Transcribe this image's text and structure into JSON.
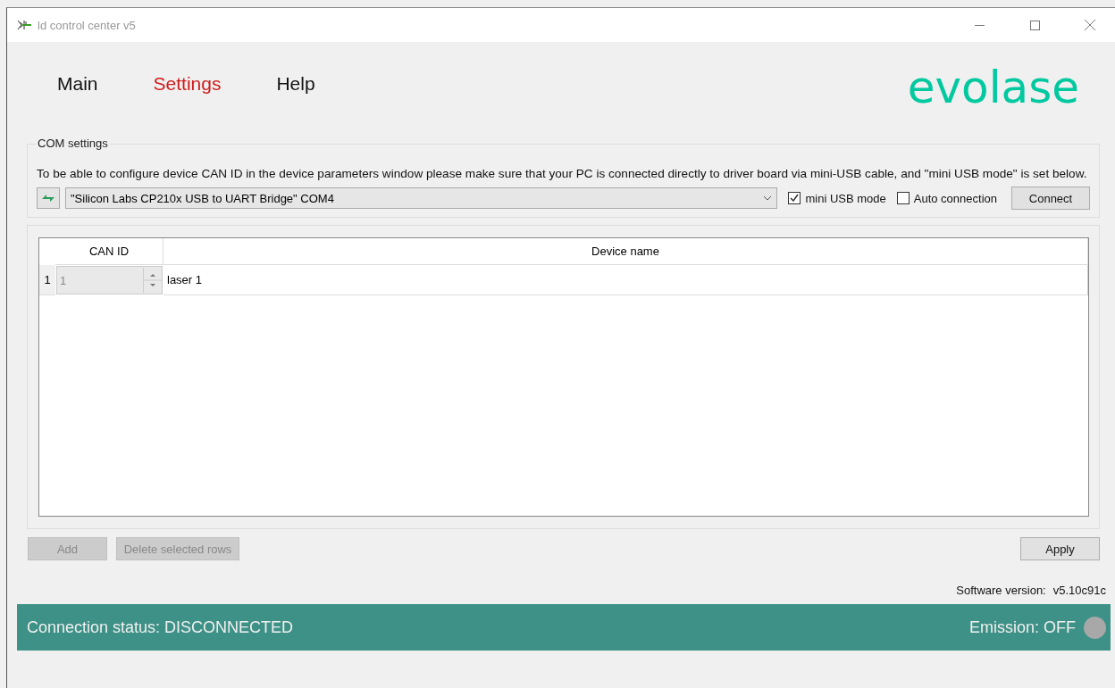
{
  "window": {
    "title": "ld control center v5"
  },
  "nav": [
    {
      "label": "Main",
      "selected": false
    },
    {
      "label": "Settings",
      "selected": true
    },
    {
      "label": "Help",
      "selected": false
    }
  ],
  "logo": {
    "text": "evolase"
  },
  "com_settings": {
    "title": "COM settings",
    "description": "To be able to configure device CAN ID in the device parameters window please make sure that your PC is connected directly to driver board via mini-USB cable, and \"mini USB mode\" is set below.",
    "port": "\"Silicon Labs CP210x USB to UART Bridge\" COM4",
    "options": [
      {
        "label": "mini USB mode",
        "checked": true
      },
      {
        "label": "Auto connection",
        "checked": false
      }
    ],
    "connect_button": "Connect"
  },
  "table": {
    "columns": [
      "CAN ID",
      "Device name"
    ],
    "rows": [
      {
        "index": "1",
        "can_id": "1",
        "device_name": "laser 1"
      }
    ]
  },
  "buttons": [
    {
      "label": "Add",
      "disabled": true
    },
    {
      "label": "Delete selected rows",
      "disabled": true
    }
  ],
  "apply_button": "Apply",
  "software_version": {
    "label": "Software version:",
    "value": "v5.10c91c"
  },
  "status_bar": {
    "connection": "Connection status: DISCONNECTED",
    "emission": "Emission: OFF",
    "emission_on": false
  }
}
